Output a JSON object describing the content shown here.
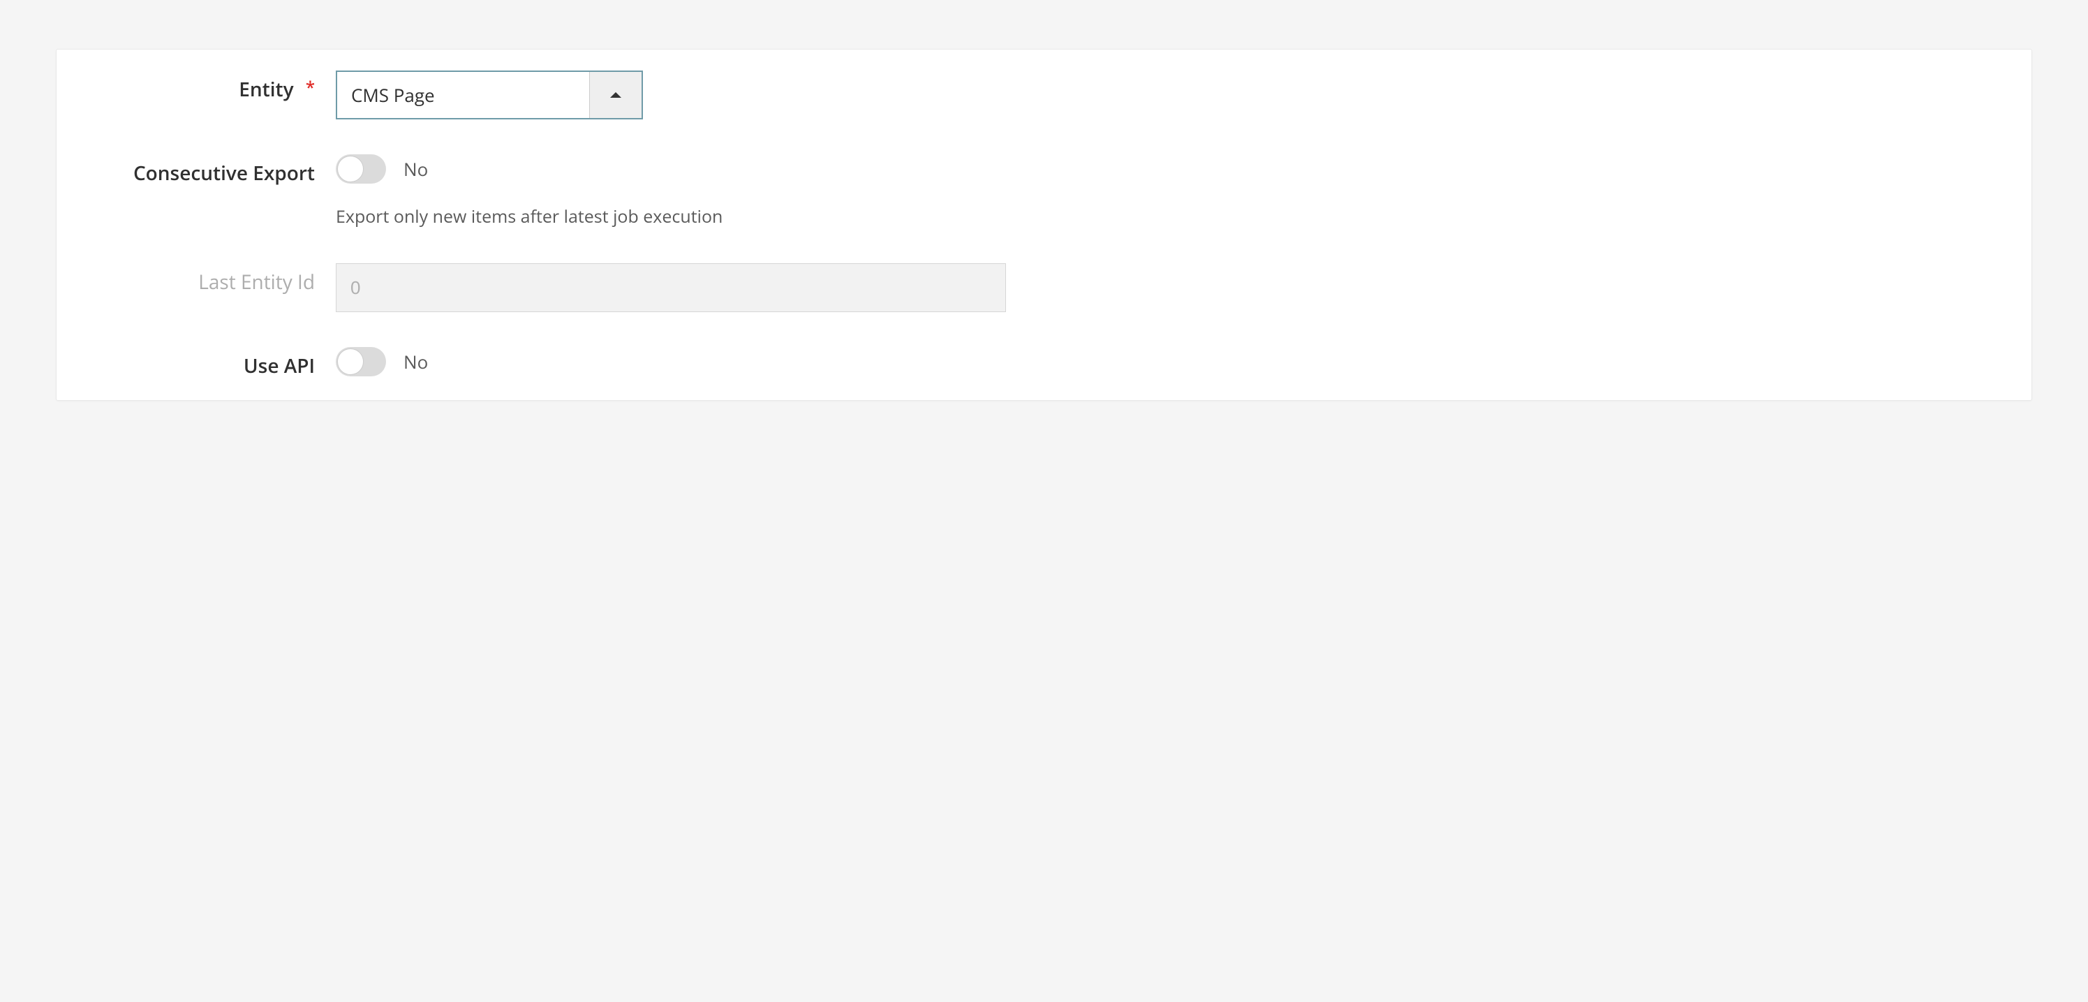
{
  "fields": {
    "entity": {
      "label": "Entity",
      "required_mark": "*",
      "value": "CMS Page"
    },
    "consecutive_export": {
      "label": "Consecutive Export",
      "state_text": "No",
      "helper": "Export only new items after latest job execution"
    },
    "last_entity_id": {
      "label": "Last Entity Id",
      "value": "0"
    },
    "use_api": {
      "label": "Use API",
      "state_text": "No"
    }
  }
}
